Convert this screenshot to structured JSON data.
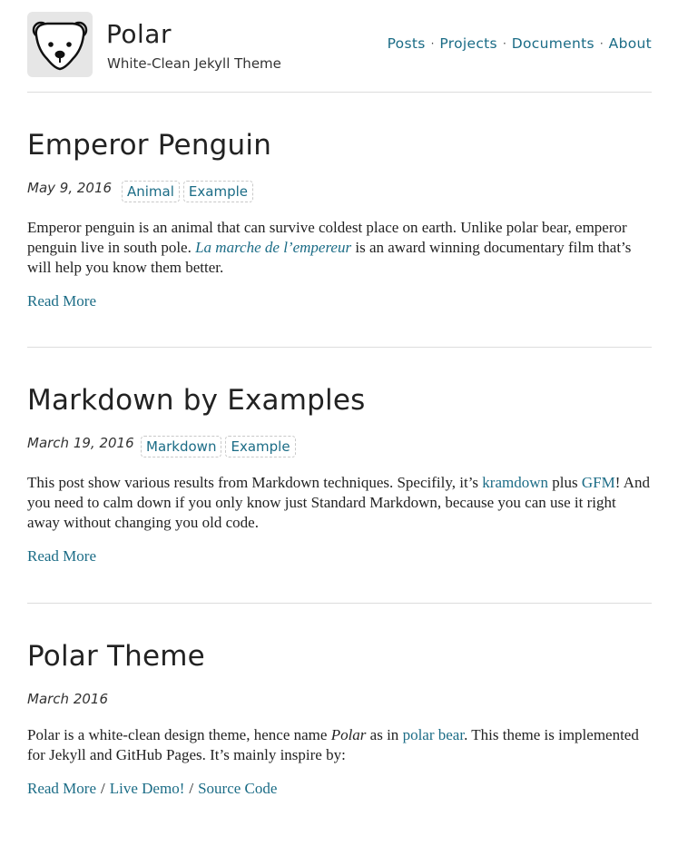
{
  "site": {
    "title": "Polar",
    "subtitle": "White-Clean Jekyll Theme",
    "logo_icon": "polar-bear-icon"
  },
  "nav": {
    "items": [
      "Posts",
      "Projects",
      "Documents",
      "About"
    ],
    "separator": "·"
  },
  "colors": {
    "link": "#1b6c86",
    "text": "#222222",
    "rule": "#dddddd"
  },
  "posts": [
    {
      "title": "Emperor Penguin",
      "date": "May 9, 2016",
      "tags": [
        "Animal",
        "Example"
      ],
      "excerpt": {
        "p1": "Emperor penguin is an animal that can survive coldest place on earth. Unlike polar bear, emperor penguin live in south pole. ",
        "link": "La marche de l’empereur",
        "p2": " is an award winning documentary film that’s will help you know them better."
      },
      "read_more": "Read More"
    },
    {
      "title": "Markdown by Examples",
      "date": "March 19, 2016",
      "tags": [
        "Markdown",
        "Example"
      ],
      "excerpt": {
        "p1": "This post show various results from Markdown techniques. Specifily, it’s ",
        "link1": "kramdown",
        "p2": " plus ",
        "link2": "GFM",
        "p3": "! And you need to calm down if you only know just Standard Markdown, because you can use it right away without changing you old code."
      },
      "read_more": "Read More"
    },
    {
      "title": "Polar Theme",
      "date": "March 2016",
      "excerpt": {
        "p1": "Polar is a white-clean design theme, hence name ",
        "em": "Polar",
        "p2": " as in ",
        "link": "polar bear",
        "p3": ". This theme is implemented for Jekyll and GitHub Pages. It’s mainly inspire by:"
      },
      "read_more": "Read More",
      "live_demo": "Live Demo!",
      "source_code": "Source Code",
      "slash": "/"
    }
  ]
}
